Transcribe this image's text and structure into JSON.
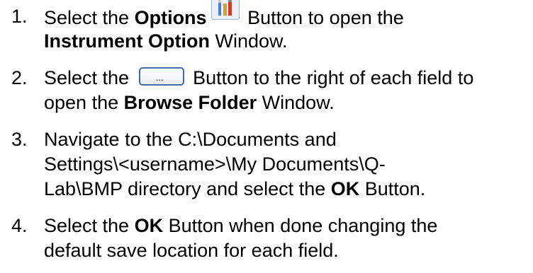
{
  "steps": [
    {
      "number": "1.",
      "lines": [
        {
          "a": "Select the ",
          "b": "Options",
          "c": " Button to open the"
        },
        {
          "b": "Instrument Option",
          "c": " Window."
        }
      ]
    },
    {
      "number": "2.",
      "lines": [
        {
          "a": "Select the ",
          "c": " Button to the right of each field to"
        },
        {
          "a": "open the ",
          "b": "Browse Folder",
          "c": " Window."
        }
      ]
    },
    {
      "number": "3.",
      "lines": [
        {
          "a": "Navigate to the C:\\Documents and"
        },
        {
          "a": "Settings\\<username>\\My Documents\\Q-"
        },
        {
          "a": "Lab\\BMP directory and select the ",
          "b": "OK",
          "c": " Button."
        }
      ]
    },
    {
      "number": "4.",
      "lines": [
        {
          "a": "Select the ",
          "b": "OK",
          "c": " Button when done changing the"
        },
        {
          "a": "default save location for each field."
        }
      ]
    }
  ],
  "icons": {
    "options_button_icon": "options-icon",
    "browse_button_icon": "ellipsis-button-icon",
    "browse_button_glyph": "..."
  },
  "colors": {
    "text": "#000000",
    "background": "#ffffff",
    "button_border": "#3f6fa8"
  }
}
